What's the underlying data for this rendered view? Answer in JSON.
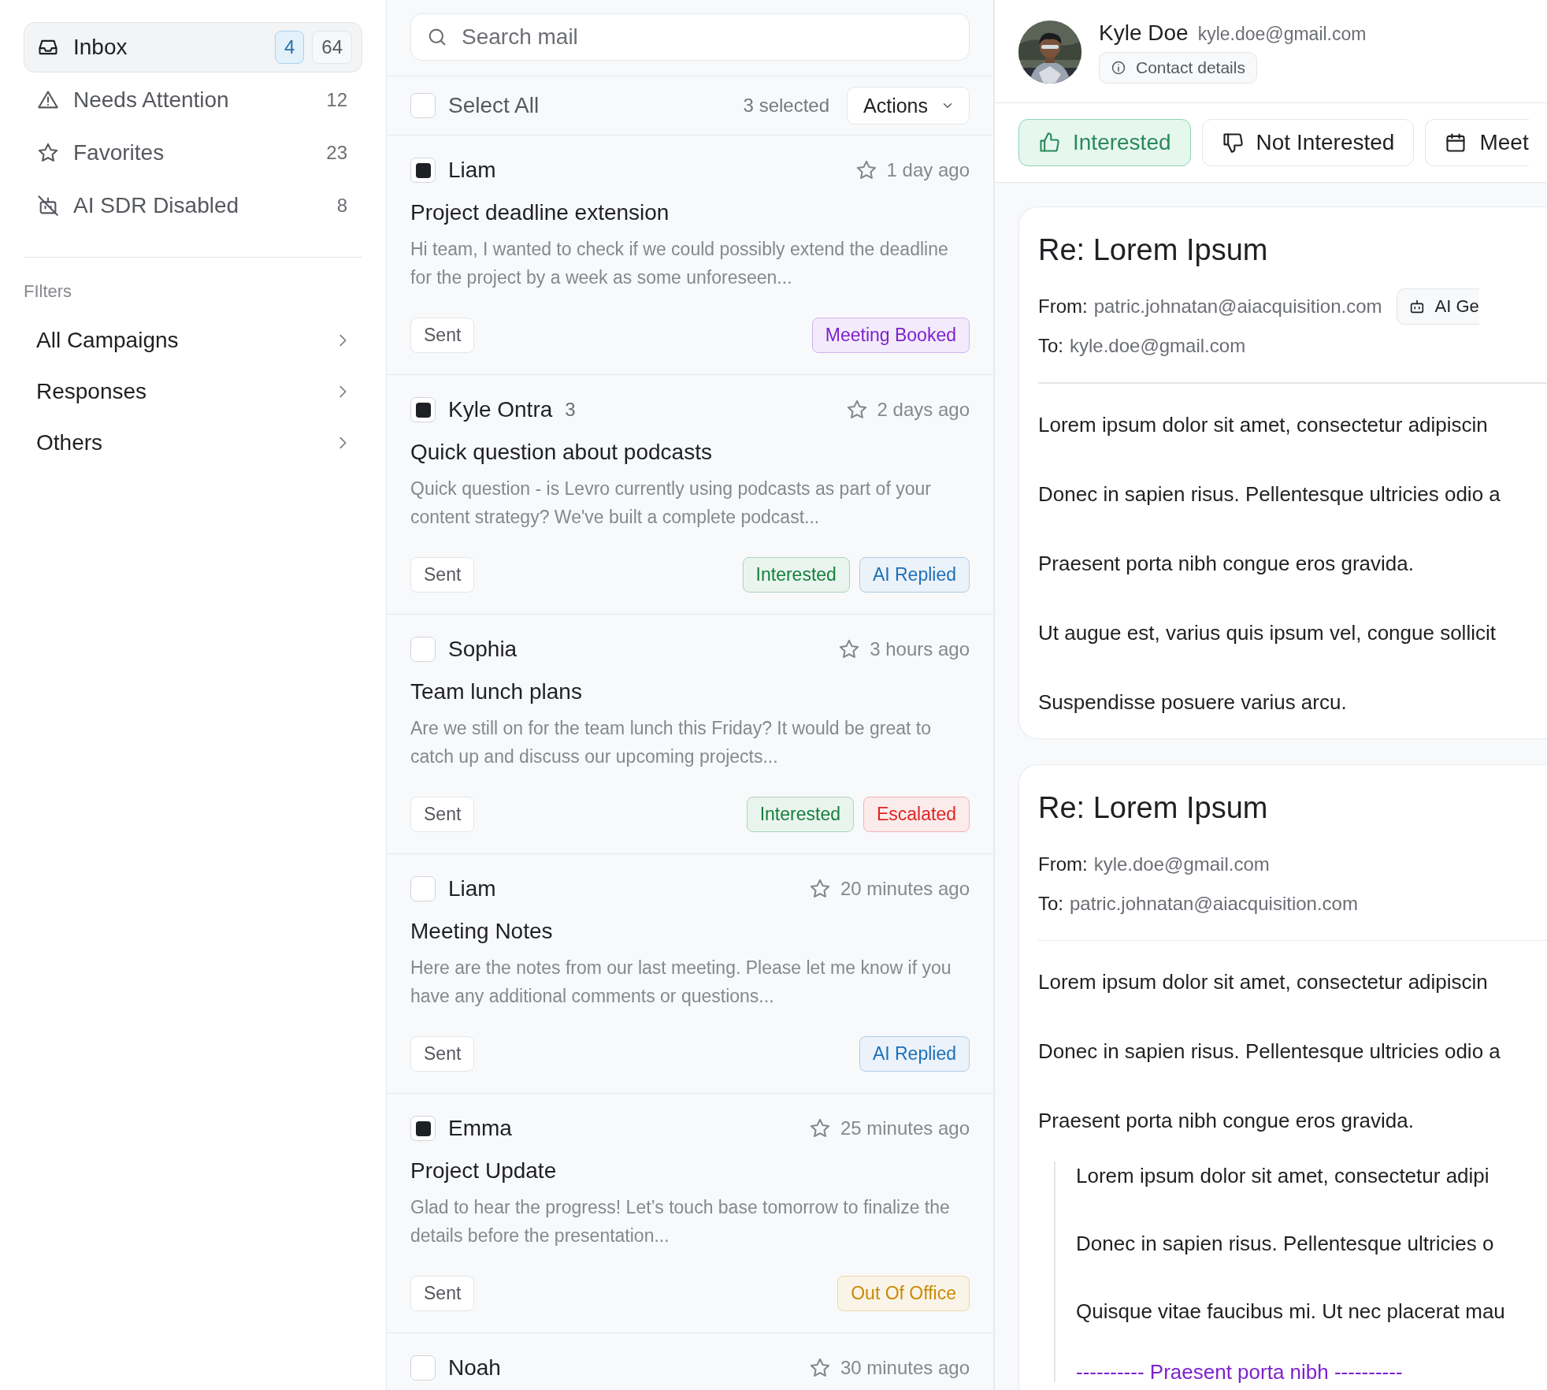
{
  "sidebar": {
    "mailboxes": [
      {
        "label": "Inbox",
        "kind": "inbox",
        "selected": true,
        "unread": "4",
        "count": "64"
      },
      {
        "label": "Needs Attention",
        "kind": "alert",
        "selected": false,
        "count": "12"
      },
      {
        "label": "Favorites",
        "kind": "star",
        "selected": false,
        "count": "23"
      },
      {
        "label": "AI SDR Disabled",
        "kind": "bot-off",
        "selected": false,
        "count": "8"
      }
    ],
    "filters_heading": "FIlters",
    "filters": [
      {
        "label": "All Campaigns"
      },
      {
        "label": "Responses"
      },
      {
        "label": "Others"
      }
    ]
  },
  "mail_list": {
    "search": {
      "placeholder": "Search mail"
    },
    "select_all": {
      "label": "Select All",
      "checked": false
    },
    "selected_count": "3 selected",
    "actions_button": "Actions",
    "emails": [
      {
        "sender": "Liam",
        "checked": true,
        "time": "1 day ago",
        "subject": "Project deadline extension",
        "preview": "Hi team, I wanted to check if we could possibly extend the deadline for the project by a week as some unforeseen...",
        "status": "Sent",
        "tags": [
          {
            "label": "Meeting Booked",
            "color": "#7e22ce"
          }
        ]
      },
      {
        "sender": "Kyle Ontra",
        "thread_count": "3",
        "checked": true,
        "time": "2 days ago",
        "subject": "Quick question about podcasts",
        "preview": "Quick question - is Levro currently using podcasts as part of your content strategy? We've built a complete podcast...",
        "status": "Sent",
        "tags": [
          {
            "label": "Interested",
            "color": "#15803d"
          },
          {
            "label": "AI Replied",
            "color": "#1d6fb8"
          }
        ]
      },
      {
        "sender": "Sophia",
        "checked": false,
        "time": "3 hours ago",
        "subject": "Team lunch plans",
        "preview": "Are we still on for the team lunch this Friday? It would be great to catch up and discuss our upcoming projects...",
        "status": "Sent",
        "tags": [
          {
            "label": "Interested",
            "color": "#15803d"
          },
          {
            "label": "Escalated",
            "color": "#dc2626"
          }
        ]
      },
      {
        "sender": "Liam",
        "checked": false,
        "time": "20 minutes ago",
        "subject": "Meeting Notes",
        "preview": "Here are the notes from our last meeting. Please let me know if you have any additional comments or questions...",
        "status": "Sent",
        "tags": [
          {
            "label": "AI Replied",
            "color": "#1d6fb8"
          }
        ]
      },
      {
        "sender": "Emma",
        "checked": true,
        "time": "25 minutes ago",
        "subject": "Project Update",
        "preview": "Glad to hear the progress! Let’s touch base tomorrow to finalize the details before the presentation...",
        "status": "Sent",
        "tags": [
          {
            "label": "Out Of Office",
            "color": "#ca8a04"
          }
        ]
      },
      {
        "sender": "Noah",
        "checked": false,
        "time": "30 minutes ago"
      }
    ]
  },
  "contact": {
    "name": "Kyle Doe",
    "email": "kyle.doe@gmail.com",
    "details_button": "Contact details"
  },
  "response_buttons": [
    {
      "label": "Interested",
      "kind": "thumbs-up",
      "selected": true
    },
    {
      "label": "Not Interested",
      "kind": "thumbs-down",
      "selected": false
    },
    {
      "label": "Meet",
      "kind": "calendar",
      "selected": false
    }
  ],
  "thread": [
    {
      "subject": "Re: Lorem Ipsum",
      "from_label": "From:",
      "from": "patric.johnatan@aiacquisition.com",
      "to_label": "To:",
      "to": "kyle.doe@gmail.com",
      "ai_badge": "AI Ge",
      "paragraphs": [
        "Lorem ipsum dolor sit amet, consectetur adipiscin",
        "Donec in sapien risus. Pellentesque ultricies odio a",
        "Praesent porta nibh congue eros gravida.",
        "Ut augue est, varius quis ipsum vel, congue sollicit",
        "Suspendisse posuere varius arcu."
      ]
    },
    {
      "subject": "Re: Lorem Ipsum",
      "from_label": "From:",
      "from": "kyle.doe@gmail.com",
      "to_label": "To:",
      "to": "patric.johnatan@aiacquisition.com",
      "paragraphs": [
        "Lorem ipsum dolor sit amet, consectetur adipiscin",
        "Donec in sapien risus. Pellentesque ultricies odio a",
        "Praesent porta nibh congue eros gravida."
      ],
      "quote": {
        "paragraphs": [
          "Lorem ipsum dolor sit amet, consectetur adipi",
          "Donec in sapien risus. Pellentesque ultricies o",
          "Quisque vitae faucibus mi. Ut nec placerat mau"
        ],
        "separator": "---------- Praesent porta nibh ----------"
      }
    }
  ]
}
